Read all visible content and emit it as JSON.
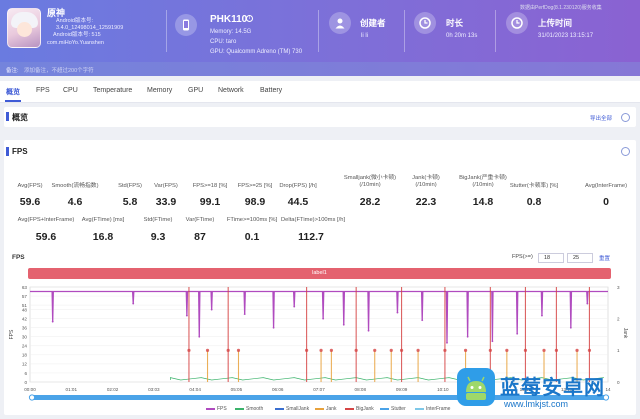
{
  "header": {
    "app": {
      "name": "原神",
      "lines": [
        "Android版本号:",
        "3.4.0_12498014_12591909",
        "Android版本号: 515",
        "com.miHoYo.Yuanshen"
      ]
    },
    "device": {
      "model": "PHK110",
      "memory": "Memory: 14.5G",
      "cpu": "CPU: taro",
      "gpu": "GPU: Qualcomm Adreno (TM) 730"
    },
    "creator": {
      "title": "创建者",
      "value": "li li"
    },
    "duration": {
      "title": "时长",
      "value": "0h 20m 13s"
    },
    "upload": {
      "title": "上传时间",
      "value": "31/01/2023 13:15:17"
    },
    "watermark": "数据由PerfDog(8.1.230120)服务收集",
    "note_label": "备注:",
    "note_placeholder": "添加备注，不超过200个字符"
  },
  "tabs": [
    "概览",
    "FPS",
    "CPU",
    "Temperature",
    "Memory",
    "GPU",
    "Network",
    "Battery"
  ],
  "overview": {
    "title": "概览",
    "export": "导出全部"
  },
  "fps_section": {
    "title": "FPS",
    "row1": [
      {
        "label": "Avg(FPS)",
        "value": "59.6"
      },
      {
        "label": "Smooth(流畅指数)",
        "value": "4.6"
      },
      {
        "label": "Std(FPS)",
        "value": "5.8"
      },
      {
        "label": "Var(FPS)",
        "value": "33.9"
      },
      {
        "label": "FPS>=18 [%]",
        "value": "99.1"
      },
      {
        "label": "FPS>=25 [%]",
        "value": "98.9"
      },
      {
        "label": "Drop(FPS) [/h]",
        "value": "44.5"
      },
      {
        "label": "Smalljank(微小卡顿)\n(/10min)",
        "value": "28.2"
      },
      {
        "label": "Jank(卡顿)\n(/10min)",
        "value": "22.3"
      },
      {
        "label": "BigJank(严重卡顿)\n(/10min)",
        "value": "14.8"
      },
      {
        "label": "Stutter(卡顿率) [%]",
        "value": "0.8"
      },
      {
        "label": "Avg(InterFrame)",
        "value": "0"
      }
    ],
    "row2": [
      {
        "label": "Avg(FPS+InterFrame)",
        "value": "59.6"
      },
      {
        "label": "Avg(FTime) [ms]",
        "value": "16.8"
      },
      {
        "label": "Std(FTime)",
        "value": "9.3"
      },
      {
        "label": "Var(FTime)",
        "value": "87"
      },
      {
        "label": "FTime>=100ms [%]",
        "value": "0.1"
      },
      {
        "label": "Delta(FTime)>100ms [/h]",
        "value": "112.7"
      }
    ]
  },
  "chart_controls": {
    "fps_ge": "FPS(>=)",
    "v1": "18",
    "v2": "25",
    "reset": "重置"
  },
  "label_bar": "label1",
  "colors": {
    "accent": "#3f5bd6",
    "fps": "#b04bbf",
    "jank": "#e8a23c",
    "bigjank": "#d64545",
    "label": "#e4626f"
  },
  "chart_data": {
    "type": "line",
    "title": "FPS",
    "ylabel": "FPS",
    "y2label": "Jank",
    "ylim": [
      0,
      63
    ],
    "y2lim": [
      0,
      3
    ],
    "yticks": [
      0,
      6,
      12,
      18,
      24,
      30,
      36,
      42,
      48,
      51,
      57,
      63
    ],
    "y2ticks": [
      0,
      1,
      2,
      3
    ],
    "x_ticks": [
      "00:00",
      "01:01",
      "02:02",
      "03:03",
      "04:04",
      "05:05",
      "06:06",
      "07:07",
      "08:08",
      "09:09",
      "10:10",
      "11:11",
      "12:12",
      "13:13",
      "14"
    ],
    "series": [
      {
        "name": "FPS",
        "baseline": 60
      },
      {
        "name": "Smooth"
      },
      {
        "name": "SmallJank"
      },
      {
        "name": "Jank"
      },
      {
        "name": "BigJank"
      },
      {
        "name": "Stutter"
      },
      {
        "name": "InterFrame"
      }
    ],
    "fps_dips": [
      {
        "t": 0.55,
        "v": 40
      },
      {
        "t": 2.5,
        "v": 52
      },
      {
        "t": 3.8,
        "v": 44
      },
      {
        "t": 4.1,
        "v": 30
      },
      {
        "t": 4.4,
        "v": 48
      },
      {
        "t": 5.2,
        "v": 45
      },
      {
        "t": 5.9,
        "v": 36
      },
      {
        "t": 6.4,
        "v": 50
      },
      {
        "t": 7.1,
        "v": 42
      },
      {
        "t": 7.6,
        "v": 38
      },
      {
        "t": 8.2,
        "v": 34
      },
      {
        "t": 8.9,
        "v": 46
      },
      {
        "t": 9.5,
        "v": 41
      },
      {
        "t": 10.1,
        "v": 26
      },
      {
        "t": 10.6,
        "v": 30
      },
      {
        "t": 11.2,
        "v": 27
      },
      {
        "t": 11.8,
        "v": 32
      },
      {
        "t": 12.4,
        "v": 44
      },
      {
        "t": 13.1,
        "v": 36
      },
      {
        "t": 13.5,
        "v": 52
      }
    ],
    "jank_events": [
      {
        "t": 3.85,
        "k": "bigjank"
      },
      {
        "t": 4.3,
        "k": "jank"
      },
      {
        "t": 4.8,
        "k": "bigjank"
      },
      {
        "t": 5.05,
        "k": "jank"
      },
      {
        "t": 6.7,
        "k": "bigjank"
      },
      {
        "t": 7.05,
        "k": "jank"
      },
      {
        "t": 7.3,
        "k": "jank"
      },
      {
        "t": 7.9,
        "k": "bigjank"
      },
      {
        "t": 8.35,
        "k": "jank"
      },
      {
        "t": 8.75,
        "k": "jank"
      },
      {
        "t": 9.0,
        "k": "bigjank"
      },
      {
        "t": 9.4,
        "k": "jank"
      },
      {
        "t": 10.05,
        "k": "bigjank"
      },
      {
        "t": 10.55,
        "k": "jank"
      },
      {
        "t": 11.15,
        "k": "bigjank"
      },
      {
        "t": 11.55,
        "k": "jank"
      },
      {
        "t": 12.0,
        "k": "bigjank"
      },
      {
        "t": 12.45,
        "k": "jank"
      },
      {
        "t": 12.75,
        "k": "bigjank"
      },
      {
        "t": 13.25,
        "k": "jank"
      },
      {
        "t": 13.55,
        "k": "bigjank"
      }
    ]
  },
  "site": {
    "name": "蓝莓安卓网",
    "url": "www.lmkjst.com"
  }
}
